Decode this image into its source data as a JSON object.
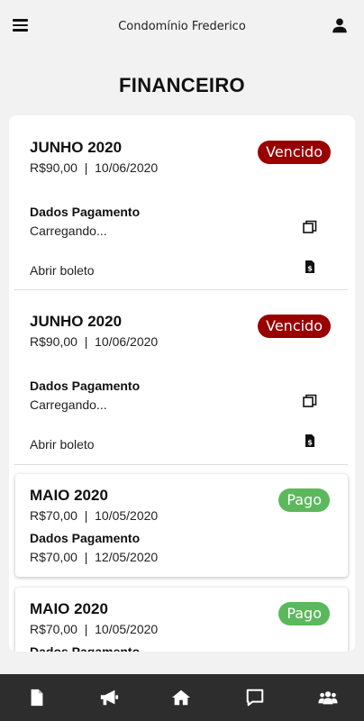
{
  "header": {
    "title": "Condomínio Frederico",
    "menu_icon": "menu-icon",
    "user_icon": "user-icon"
  },
  "page_title": "FINANCEIRO",
  "entries": [
    {
      "month": "JUNHO 2020",
      "amount_date": "R$90,00  |  10/06/2020",
      "status": "Vencido",
      "pay_label": "Dados Pagamento",
      "pay_value": "Carregando...",
      "boleto_label": "Abrir boleto"
    },
    {
      "month": "JUNHO 2020",
      "amount_date": "R$90,00  |  10/06/2020",
      "status": "Vencido",
      "pay_label": "Dados Pagamento",
      "pay_value": "Carregando...",
      "boleto_label": "Abrir boleto"
    },
    {
      "month": "MAIO 2020",
      "amount_date": "R$70,00  |  10/05/2020",
      "status": "Pago",
      "pay_label": "Dados Pagamento",
      "pay_value": "R$70,00  |  12/05/2020"
    },
    {
      "month": "MAIO 2020",
      "amount_date": "R$70,00  |  10/05/2020",
      "status": "Pago",
      "pay_label": "Dados Pagamento",
      "pay_value": ""
    }
  ],
  "bottom_nav": [
    "document-icon",
    "megaphone-icon",
    "home-icon",
    "chat-icon",
    "group-icon"
  ],
  "colors": {
    "vencido": "#990000",
    "pago": "#5cb85c",
    "bottom_bar": "#2d2d2d"
  }
}
